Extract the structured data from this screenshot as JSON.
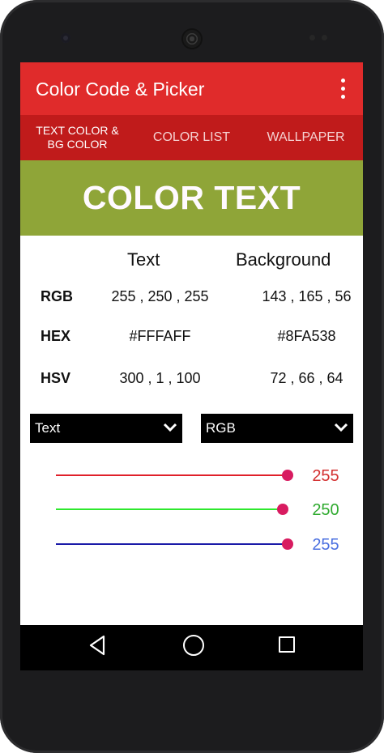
{
  "app": {
    "title": "Color Code & Picker",
    "menu_icon": "overflow-menu-icon"
  },
  "tabs": [
    {
      "label": "TEXT COLOR &\nBG COLOR",
      "selected": true
    },
    {
      "label": "COLOR LIST",
      "selected": false
    },
    {
      "label": "WALLPAPER",
      "selected": false
    }
  ],
  "preview": {
    "text": "COLOR TEXT",
    "text_color": "#FFFAFF",
    "bg_color": "#8FA538"
  },
  "table": {
    "headers": {
      "text": "Text",
      "background": "Background"
    },
    "rows": [
      {
        "label": "RGB",
        "text": "255 , 250 , 255",
        "background": "143 , 165 , 56"
      },
      {
        "label": "HEX",
        "text": "#FFFAFF",
        "background": "#8FA538"
      },
      {
        "label": "HSV",
        "text": "300 , 1 , 100",
        "background": "72 , 66 , 64"
      }
    ]
  },
  "dropdowns": {
    "target": {
      "selected": "Text"
    },
    "mode": {
      "selected": "RGB"
    }
  },
  "sliders": [
    {
      "channel": "red",
      "value": "255",
      "fraction": 1.0,
      "track_color": "#e0202a",
      "value_color": "#d32f2f"
    },
    {
      "channel": "green",
      "value": "250",
      "fraction": 0.98,
      "track_color": "#2ee82e",
      "value_color": "#2eaa2e"
    },
    {
      "channel": "blue",
      "value": "255",
      "fraction": 1.0,
      "track_color": "#1a1aa8",
      "value_color": "#4a6fe0"
    }
  ],
  "colors": {
    "app_bar": "#e02b2b",
    "tab_bar": "#c01b1b",
    "slider_thumb": "#d81b60"
  },
  "nav": {
    "back_icon": "back-icon",
    "home_icon": "home-icon",
    "recents_icon": "recents-icon"
  }
}
